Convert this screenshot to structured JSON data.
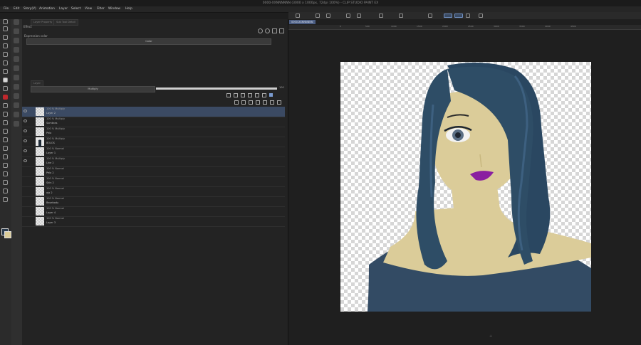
{
  "window": {
    "title": "0000-XXNNNNNN (3000 x 1000px, 72dpi 100%) - CLIP STUDIO PAINT EX"
  },
  "menu": {
    "items": [
      "File",
      "Edit",
      "Story(V)",
      "Animation",
      "Layer",
      "Select",
      "View",
      "Filter",
      "Window",
      "Help"
    ]
  },
  "sub_panel": {
    "tab_property": "Layer Property",
    "tab_navigator": "Sub Tool Detail",
    "effect_label": "Effect",
    "expression_label": "Expression color",
    "expression_value": "Color"
  },
  "layer_panel": {
    "tab_label": "Layer",
    "blend_mode": "Multiply",
    "opacity": "100",
    "layers": [
      {
        "mode": "100 % Multiply",
        "name": "Layer 2"
      },
      {
        "mode": "100 % Multiply",
        "name": "Sombras"
      },
      {
        "mode": "100 % Multiply",
        "name": "Pelo"
      },
      {
        "mode": "100 % Multiply",
        "name": "BOLOS"
      },
      {
        "mode": "100 % Normal",
        "name": "Layer 1"
      },
      {
        "mode": "100 % Multiply",
        "name": "Line 2"
      },
      {
        "mode": "100 % Normal",
        "name": "Pelo 2"
      },
      {
        "mode": "100 % Normal",
        "name": "Skin 2"
      },
      {
        "mode": "100 % Normal",
        "name": "ojo 2"
      },
      {
        "mode": "100 % Normal",
        "name": "Basebody"
      },
      {
        "mode": "100 % Normal",
        "name": "Layer 4"
      },
      {
        "mode": "100 % Normal",
        "name": "Layer 3"
      }
    ]
  },
  "canvas": {
    "doc_tab": "0000-XXNNNNNN",
    "ruler_ticks": [
      "0",
      "500",
      "1000",
      "1500",
      "2000",
      "2500",
      "3000",
      "3500",
      "4000",
      "4500"
    ]
  },
  "colors": {
    "hair": "#2e4d66",
    "skin": "#dbcc99",
    "shirt": "#334b64",
    "lips": "#8a1fa0",
    "accent": "#4b5d82"
  }
}
